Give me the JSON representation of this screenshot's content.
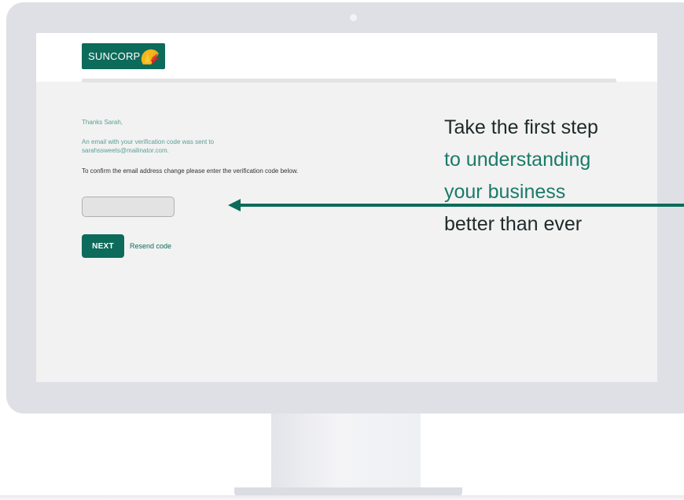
{
  "brand": {
    "logo_text": "SUNCORP",
    "primary_color": "#0d6b5b",
    "accent_color": "#1b7a68",
    "logo_icon": "sun-icon"
  },
  "verify": {
    "greeting": "Thanks Sarah,",
    "sent_message": "An email with your verification code was sent to sarahssweets@mailinator.com.",
    "confirm_message": "To confirm the email address change please enter the verification code below.",
    "code_value": "",
    "next_label": "NEXT",
    "resend_label": "Resend code"
  },
  "callout": {
    "line1": "Take the first step",
    "line2": "to understanding",
    "line3": "your business",
    "line4": "better than ever"
  }
}
